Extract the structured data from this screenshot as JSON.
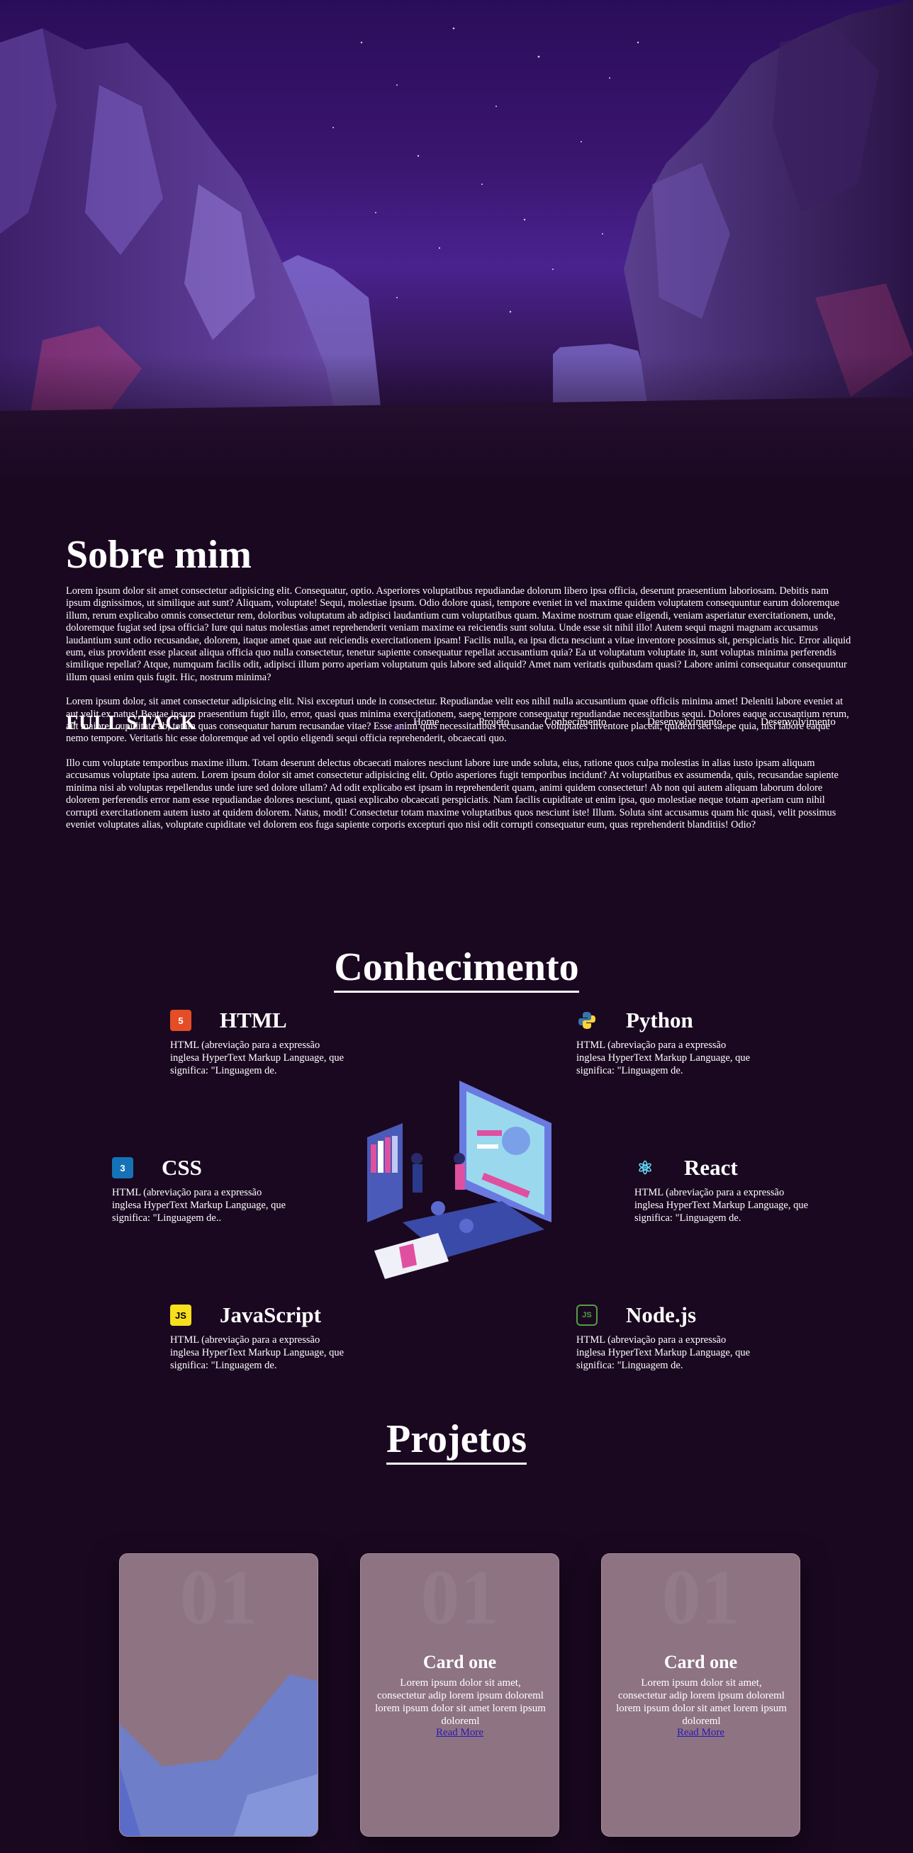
{
  "nav": {
    "brand": "FULL STACK",
    "links": [
      "Home",
      "Projeto",
      "Conhecimento",
      "Desenvolvimento",
      "Desenvolvimento"
    ]
  },
  "about": {
    "title": "Sobre mim",
    "paragraphs": [
      "Lorem ipsum dolor sit amet consectetur adipisicing elit. Consequatur, optio. Asperiores voluptatibus repudiandae dolorum libero ipsa officia, deserunt praesentium laboriosam. Debitis nam ipsum dignissimos, ut similique aut sunt? Aliquam, voluptate! Sequi, molestiae ipsum. Odio dolore quasi, tempore eveniet in vel maxime quidem voluptatem consequuntur earum doloremque illum, rerum explicabo omnis consectetur rem, doloribus voluptatum ab adipisci laudantium cum voluptatibus quam. Maxime nostrum quae eligendi, veniam asperiatur exercitationem, unde, doloremque fugiat sed ipsa officia? Iure qui natus molestias amet reprehenderit veniam maxime ea reiciendis sunt soluta. Unde esse sit nihil illo! Autem sequi magni magnam accusamus laudantium sunt odio recusandae, dolorem, itaque amet quae aut reiciendis exercitationem ipsam! Facilis nulla, ea ipsa dicta nesciunt a vitae inventore possimus sit, perspiciatis hic. Error aliquid eum, eius provident esse placeat aliqua officia quo nulla consectetur, tenetur sapiente consequatur repellat accusantium quia? Ea ut voluptatum voluptate in, sunt voluptas minima perferendis similique repellat? Atque, numquam facilis odit, adipisci illum porro aperiam voluptatum quis labore sed aliquid? Amet nam veritatis quibusdam quasi? Labore animi consequatur consequuntur illum quasi enim quis fugit. Hic, nostrum minima?",
      "Lorem ipsum dolor, sit amet consectetur adipisicing elit. Nisi excepturi unde in consectetur. Repudiandae velit eos nihil nulla accusantium quae officiis minima amet! Deleniti labore eveniet at aut velit ex natus! Beatae ipsum praesentium fugit illo, error, quasi quas minima exercitationem, saepe tempore consequatur repudiandae necessitatibus sequi. Dolores eaque accusantium rerum, aut maiores cupiditate ab, totam quas consequatur harum recusandae vitae? Esse animi quis necessitatibus recusandae voluptates inventore placeat, quidem sed saepe quia, nisi labore eaque nemo tempore. Veritatis hic esse doloremque ad vel optio eligendi sequi officia reprehenderit, obcaecati quo.",
      "Illo cum voluptate temporibus maxime illum. Totam deserunt delectus obcaecati maiores nesciunt labore iure unde soluta, eius, ratione quos culpa molestias in alias iusto ipsam aliquam accusamus voluptate ipsa autem. Lorem ipsum dolor sit amet consectetur adipisicing elit. Optio asperiores fugit temporibus incidunt? At voluptatibus ex assumenda, quis, recusandae sapiente minima nisi ab voluptas repellendus unde iure sed dolore ullam? Ad odit explicabo est ipsam in reprehenderit quam, animi quidem consectetur! Ab non qui autem aliquam laborum dolore dolorem perferendis error nam esse repudiandae dolores nesciunt, quasi explicabo obcaecati perspiciatis. Nam facilis cupiditate ut enim ipsa, quo molestiae neque totam aperiam cum nihil corrupti exercitationem autem iusto at quidem dolorem. Natus, modi! Consectetur totam maxime voluptatibus quos nesciunt iste! Illum. Soluta sint accusamus quam hic quasi, velit possimus eveniet voluptates alias, voluptate cupiditate vel dolorem eos fuga sapiente corporis excepturi quo nisi odit corrupti consequatur eum, quas reprehenderit blanditiis! Odio?"
    ]
  },
  "knowledge": {
    "title": "Conhecimento",
    "skills": [
      {
        "name": "HTML",
        "icon": "html5-icon",
        "icon_glyph": "5",
        "color": "#e44d26",
        "desc": "HTML (abreviação para a expressão inglesa HyperText Markup Language, que significa: \"Linguagem de."
      },
      {
        "name": "Python",
        "icon": "python-icon",
        "icon_glyph": "",
        "color": "#3776ab",
        "desc": "HTML (abreviação para a expressão inglesa HyperText Markup Language, que significa: \"Linguagem de."
      },
      {
        "name": "CSS",
        "icon": "css3-icon",
        "icon_glyph": "3",
        "color": "#1572b6",
        "desc": "HTML (abreviação para a expressão inglesa HyperText Markup Language, que significa: \"Linguagem de.."
      },
      {
        "name": "React",
        "icon": "react-icon",
        "icon_glyph": "⚛",
        "color": "#61dafb",
        "desc": "HTML (abreviação para a expressão inglesa HyperText Markup Language, que significa: \"Linguagem de."
      },
      {
        "name": "JavaScript",
        "icon": "javascript-icon",
        "icon_glyph": "JS",
        "color": "#f7df1e",
        "desc": "HTML (abreviação para a expressão inglesa HyperText Markup Language, que significa: \"Linguagem de."
      },
      {
        "name": "Node.js",
        "icon": "nodejs-icon",
        "icon_glyph": "JS",
        "color": "#539e43",
        "desc": "HTML (abreviação para a expressão inglesa HyperText Markup Language, que significa: \"Linguagem de."
      }
    ]
  },
  "projects": {
    "title": "Projetos",
    "cards": [
      {
        "num": "01",
        "title": "",
        "text": "",
        "link": ""
      },
      {
        "num": "01",
        "title": "Card one",
        "text": "Lorem ipsum dolor sit amet, consectetur adip lorem ipsum doloreml lorem ipsum dolor sit amet lorem ipsum doloreml",
        "link": "Read More"
      },
      {
        "num": "01",
        "title": "Card one",
        "text": "Lorem ipsum dolor sit amet, consectetur adip lorem ipsum doloreml lorem ipsum dolor sit amet lorem ipsum doloreml",
        "link": "Read More"
      }
    ]
  }
}
